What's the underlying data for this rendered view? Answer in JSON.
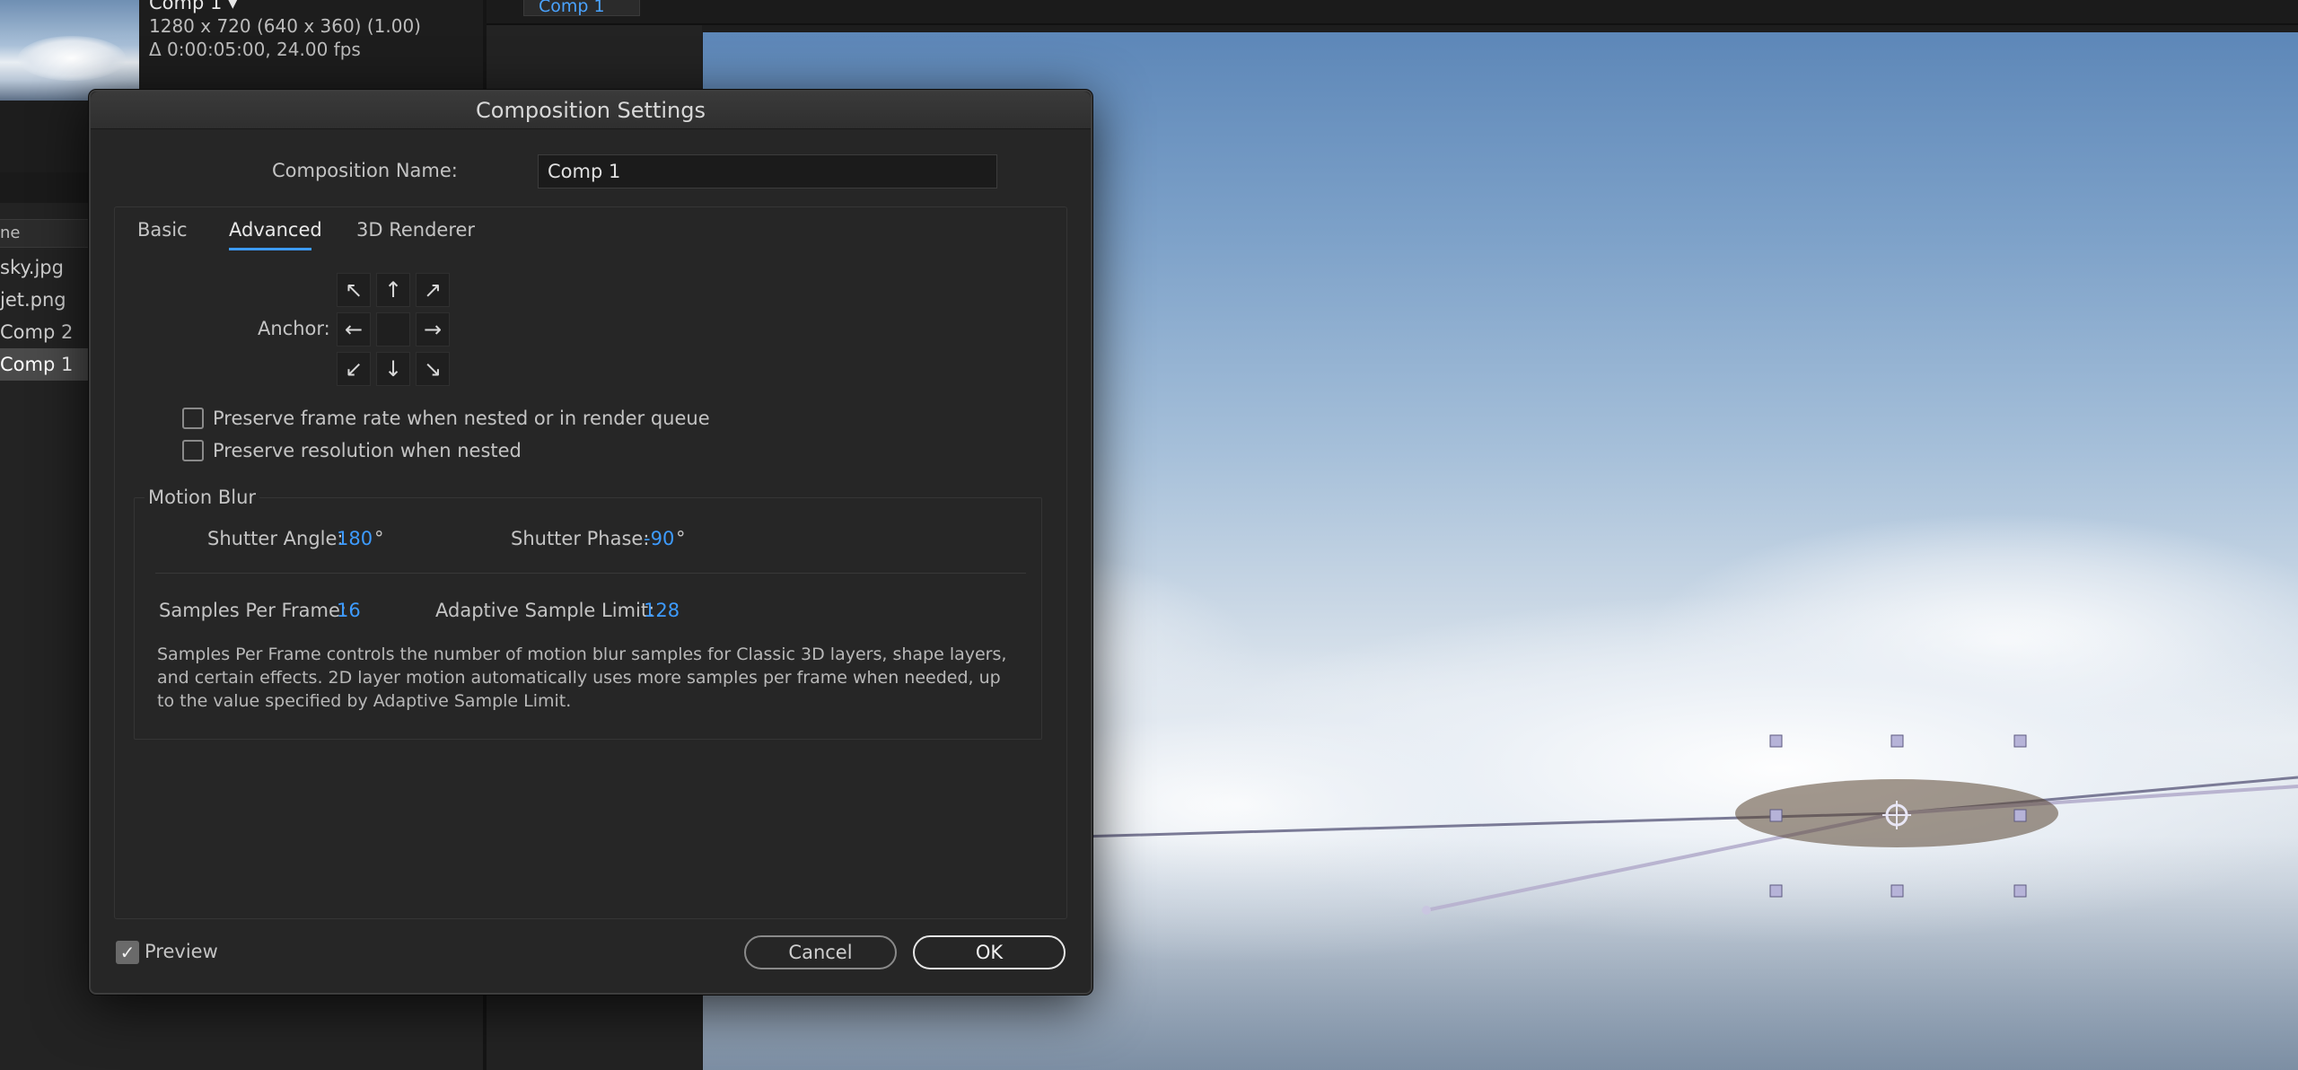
{
  "project": {
    "comp_name": "Comp 1 ▾",
    "resolution": "1280 x 720  (640 x 360) (1.00)",
    "duration": "Δ 0:00:05:00, 24.00 fps",
    "column_header": "ne",
    "items": [
      "sky.jpg",
      "jet.png",
      "Comp 2",
      "Comp 1"
    ],
    "selected_index": 3
  },
  "viewer": {
    "tab_label": "Comp 1"
  },
  "dialog": {
    "title": "Composition Settings",
    "name_label": "Composition Name:",
    "name_value": "Comp 1",
    "tabs": [
      "Basic",
      "Advanced",
      "3D Renderer"
    ],
    "active_tab": "Advanced",
    "anchor_label": "Anchor:",
    "anchor_arrows": [
      "↖",
      "↑",
      "↗",
      "←",
      "",
      "→",
      "↙",
      "↓",
      "↘"
    ],
    "preserve_frame_rate_label": "Preserve frame rate when nested or in render queue",
    "preserve_frame_rate_checked": false,
    "preserve_resolution_label": "Preserve resolution when nested",
    "preserve_resolution_checked": false,
    "motion_blur": {
      "title": "Motion Blur",
      "shutter_angle_label": "Shutter Angle:",
      "shutter_angle_value": "180",
      "shutter_angle_unit": "°",
      "shutter_phase_label": "Shutter Phase:",
      "shutter_phase_value": "-90",
      "shutter_phase_unit": "°",
      "samples_per_frame_label": "Samples Per Frame:",
      "samples_per_frame_value": "16",
      "adaptive_sample_limit_label": "Adaptive Sample Limit:",
      "adaptive_sample_limit_value": "128",
      "description": "Samples Per Frame controls the number of motion blur samples for Classic 3D layers, shape layers, and certain effects. 2D layer motion automatically uses more samples per frame when needed, up to the value specified by Adaptive Sample Limit."
    },
    "preview_label": "Preview",
    "preview_checked": true,
    "cancel_label": "Cancel",
    "ok_label": "OK"
  },
  "colors": {
    "accent": "#3d9bff",
    "dialog_bg": "#262626",
    "panel_bg": "#232323"
  }
}
